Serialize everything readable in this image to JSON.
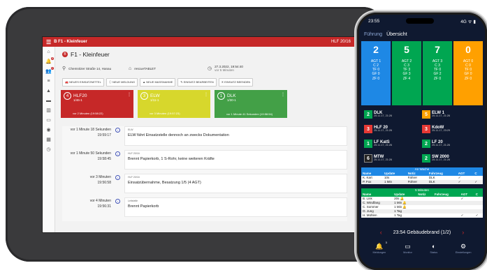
{
  "tablet": {
    "topbar": {
      "title": "B F1 - Kleinfeuer",
      "right": "HLF 20/16"
    },
    "rail_badges": [
      "4",
      "1"
    ],
    "incident": {
      "badge": "B",
      "title": "F1 - Kleinfeuer",
      "address": "Chemnitzer Straße 14, Hanau",
      "source": "rescueTABLET",
      "datetime": "27.3.2022, 19:54:40",
      "elapsed": "vor 5 Minuten"
    },
    "buttons": [
      "NEUES EINSATZMITTEL",
      "NEUE MELDUNG",
      "NEUE MASSNAHME",
      "EINSATZ BEARBEITEN",
      "EINSATZ BEENDEN"
    ],
    "cards": [
      {
        "num": "4",
        "name": "HLF20",
        "code": "1/46-1",
        "status": "vor 2 Minuten (19:58:22)",
        "color": "#c62828"
      },
      {
        "num": "3",
        "name": "ELW",
        "code": "1/11-1",
        "status": "vor 3 Minuten (19:57:23)",
        "color": "#d7d72c"
      },
      {
        "num": "1",
        "name": "DLK",
        "code": "1/30-1",
        "status": "vor 1 Minute 41 Sekunden (19:58:54)",
        "color": "#43a047"
      }
    ],
    "events": [
      {
        "ago": "vor 1 Minute 18 Sekunden",
        "time": "19:59:17",
        "vehicle": "ELW",
        "text": "ELW fährt Einsatzstelle dennoch an zwecks Dokumentation"
      },
      {
        "ago": "vor 1 Minute 50 Sekunden",
        "time": "19:58:45",
        "vehicle": "HLF 20/16",
        "text": "Brennt Papierkorb, 1 S-Rohr, keine weiteren Kräfte"
      },
      {
        "ago": "vor 3 Minuten",
        "time": "19:56:58",
        "vehicle": "HLF 20/16",
        "text": "Einsatzübernahme, Besatzung 1/5 (4 AGT)"
      },
      {
        "ago": "vor 4 Minuten",
        "time": "19:56:31",
        "vehicle": "Leitstelle",
        "text": "Brennt Papierkorb"
      }
    ]
  },
  "phone": {
    "clock": "23:55",
    "status_icons": "4G ᯤ ▮",
    "tabs": [
      "Führung",
      "Übersicht"
    ],
    "tiles": [
      {
        "big": "2",
        "color": "#1e88e5",
        "lines": [
          "AGT 1",
          "C 2",
          "TF 0",
          "GF 0",
          "ZF 0"
        ]
      },
      {
        "big": "5",
        "color": "#00a651",
        "lines": [
          "AGT 2",
          "C 3",
          "TF 3",
          "GF 3",
          "ZF 4"
        ]
      },
      {
        "big": "7",
        "color": "#00a651",
        "lines": [
          "AGT 3",
          "C 3",
          "TF 0",
          "GF 2",
          "ZF 0"
        ]
      },
      {
        "big": "0",
        "color": "#ffa000",
        "lines": [
          "AGT 0",
          "C 0",
          "TF 0",
          "GF 0",
          "ZF 0"
        ]
      }
    ],
    "vehicles": [
      {
        "n": "2",
        "c": "#00a651",
        "name": "DLK",
        "t": "25.11.17, 21:26"
      },
      {
        "n": "5",
        "c": "#ffa000",
        "name": "ELW 1",
        "t": "25.11.17, 21:26"
      },
      {
        "n": "3",
        "c": "#e53935",
        "name": "HLF 20",
        "t": "25.11.17, 21:26"
      },
      {
        "n": "3",
        "c": "#e53935",
        "name": "KdoW",
        "t": "25.11.17, 23:29"
      },
      {
        "n": "1",
        "c": "#00a651",
        "name": "LF KatS",
        "t": "25.11.17, 21:26"
      },
      {
        "n": "2",
        "c": "#00a651",
        "name": "LF 20",
        "t": "25.11.17, 21:26"
      },
      {
        "n": "6",
        "c": "#222222",
        "name": "MTW",
        "t": "25.11.17, 21:26"
      },
      {
        "n": "2",
        "c": "#00a651",
        "name": "SW 2000",
        "t": "25.11.17, 21:26"
      }
    ],
    "table1": {
      "title": "An Wache",
      "headers": [
        "Name",
        "Update",
        "Notiz",
        "Fahrzeug",
        "AGT",
        "C"
      ],
      "rows": [
        [
          "K. Kart",
          "10s",
          "Fahrer",
          "DLK",
          "✓",
          ""
        ],
        [
          "P. Fox",
          "1 Min",
          "Führer",
          "DLK",
          "✓",
          "✓"
        ]
      ]
    },
    "table2": {
      "title": "5 Minuten",
      "headers": [
        "Name",
        "Update",
        "Notiz",
        "Fahrzeug",
        "AGT",
        "C"
      ],
      "rows": [
        [
          "B. Link",
          "20s 🔔",
          "",
          "",
          "✓",
          ""
        ],
        [
          "C. Windfang",
          "1 Min 🔔",
          "",
          "",
          "",
          ""
        ],
        [
          "C. Sommer",
          "1 Min 🔔",
          "",
          "",
          "",
          ""
        ],
        [
          "O. Jung",
          "1 Tag",
          "",
          "",
          "",
          ""
        ],
        [
          "H. Mühlen",
          "1 Tag",
          "",
          "",
          "✓",
          "✓"
        ]
      ]
    },
    "bottom_bar": "23:54 Gebäudebrand (1/2)",
    "nav": [
      {
        "icon": "🔔",
        "label": "Meldungen",
        "badge": "3"
      },
      {
        "icon": "▭",
        "label": "Monitor",
        "badge": ""
      },
      {
        "icon": "◐",
        "label": "Status",
        "badge": ""
      },
      {
        "icon": "⚙",
        "label": "Einstellungen",
        "badge": ""
      }
    ]
  }
}
